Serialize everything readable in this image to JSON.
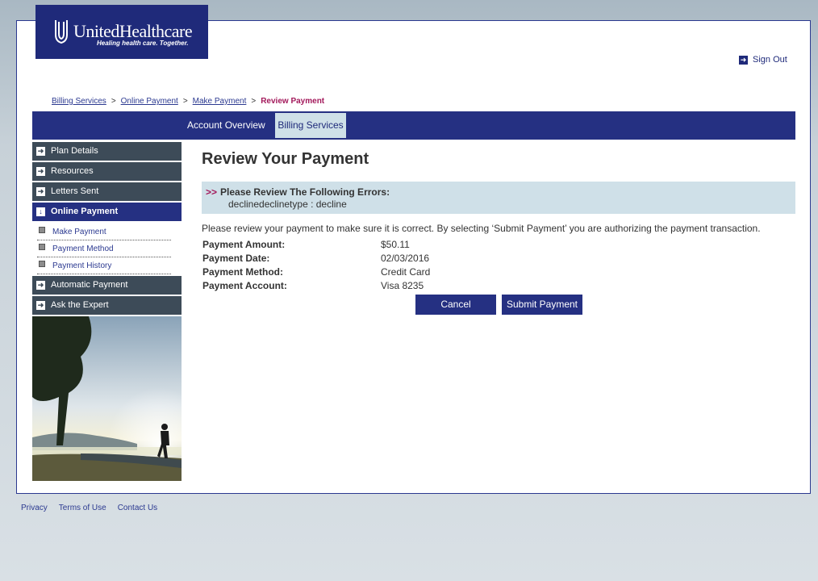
{
  "brand": {
    "name": "UnitedHealthcare",
    "tagline": "Healing health care. Together.",
    "logo_color": "#1f2a7a"
  },
  "header": {
    "sign_out_label": "Sign Out",
    "sign_out_icon": "arrow-right-icon"
  },
  "breadcrumb": {
    "items": [
      "Billing Services",
      "Online Payment",
      "Make Payment"
    ],
    "separator": ">",
    "current": "Review Payment"
  },
  "topnav": {
    "tabs": [
      {
        "label": "Account Overview",
        "active": false
      },
      {
        "label": "Billing Services",
        "active": true
      }
    ]
  },
  "sidebar": {
    "items": [
      {
        "label": "Plan Details",
        "icon": "arrow-right-icon"
      },
      {
        "label": "Resources",
        "icon": "arrow-right-icon"
      },
      {
        "label": "Letters Sent",
        "icon": "arrow-right-icon"
      },
      {
        "label": "Online Payment",
        "icon": "arrow-down-icon",
        "active": true
      },
      {
        "label": "Automatic Payment",
        "icon": "arrow-right-icon"
      },
      {
        "label": "Ask the Expert",
        "icon": "arrow-right-icon"
      }
    ],
    "subitems": [
      {
        "label": "Make Payment"
      },
      {
        "label": "Payment Method"
      },
      {
        "label": "Payment History"
      }
    ]
  },
  "main": {
    "title": "Review Your Payment",
    "errors": {
      "marker": ">>",
      "heading": "Please Review The Following Errors:",
      "message": "declinedeclinetype : decline"
    },
    "note": "Please review your payment to make sure it is correct. By selecting ‘Submit Payment’ you are authorizing the payment transaction.",
    "details": [
      {
        "label": "Payment Amount:",
        "value": "$50.11"
      },
      {
        "label": "Payment Date:",
        "value": "02/03/2016"
      },
      {
        "label": "Payment Method:",
        "value": "Credit Card"
      },
      {
        "label": "Payment Account:",
        "value": "Visa 8235"
      }
    ],
    "cancel_label": "Cancel",
    "submit_label": "Submit Payment"
  },
  "footer": {
    "links": [
      "Privacy",
      "Terms of Use",
      "Contact Us"
    ]
  },
  "colors": {
    "nav_blue": "#253082",
    "sidebar_gray": "#3d4b58",
    "error_bg": "#cfe0e8",
    "accent_magenta": "#a3195b"
  }
}
